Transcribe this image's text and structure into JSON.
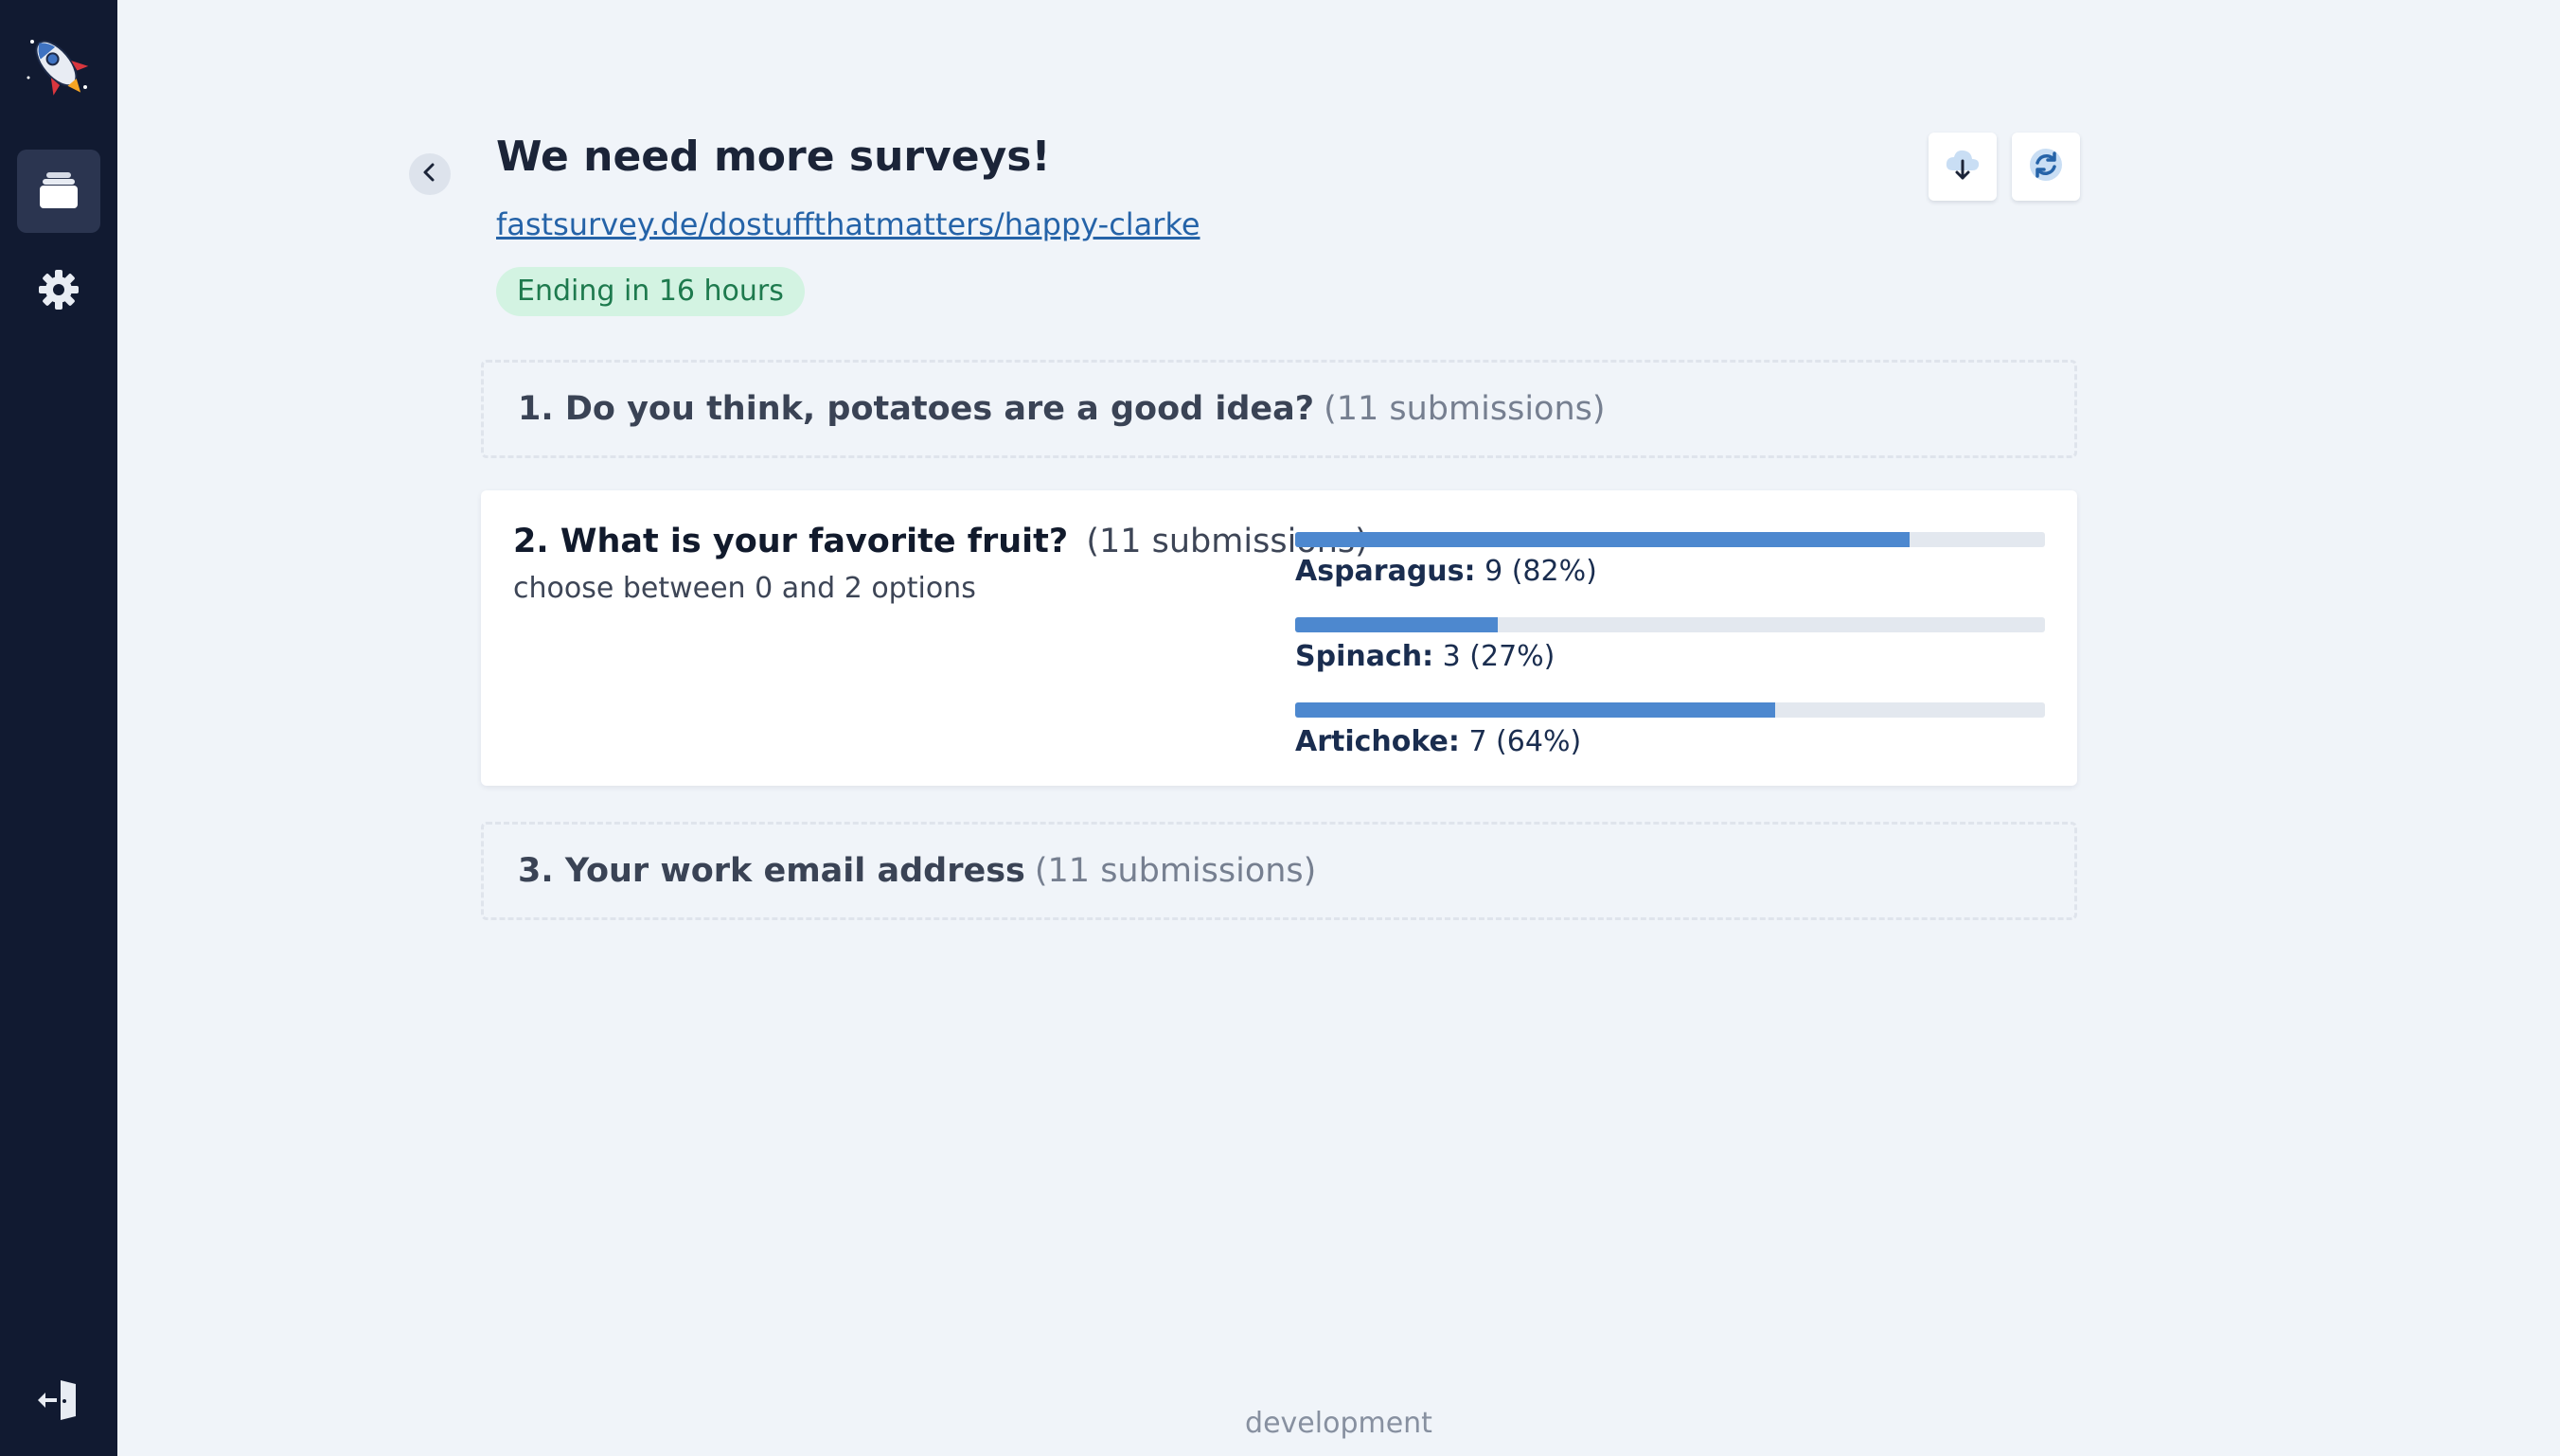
{
  "app": {
    "nav": [
      {
        "id": "surveys",
        "icon": "surveys-stack-icon",
        "active": true
      },
      {
        "id": "settings",
        "icon": "gear-icon",
        "active": false
      }
    ],
    "logout_icon": "logout-icon",
    "logo_icon": "rocket-logo-icon"
  },
  "header": {
    "title": "We need more surveys!",
    "link": "fastsurvey.de/dostuffthatmatters/happy-clarke",
    "status_badge": "Ending in 16 hours",
    "actions": [
      {
        "id": "download",
        "icon": "cloud-download-icon"
      },
      {
        "id": "refresh",
        "icon": "refresh-icon"
      }
    ]
  },
  "questions": [
    {
      "title": "1. Do you think, potatoes are a good idea?",
      "submissions": "(11 submissions)",
      "expanded": false
    },
    {
      "title": "2. What is your favorite fruit?",
      "submissions": "(11 submissions)",
      "hint": "choose between 0 and 2 options",
      "expanded": true,
      "results": [
        {
          "name": "Asparagus:",
          "count": 9,
          "stat": "9 (82%)",
          "fraction": 0.82
        },
        {
          "name": "Spinach:",
          "count": 3,
          "stat": "3 (27%)",
          "fraction": 0.27
        },
        {
          "name": "Artichoke:",
          "count": 7,
          "stat": "7 (64%)",
          "fraction": 0.64
        }
      ]
    },
    {
      "title": "3. Your work email address",
      "submissions": "(11 submissions)",
      "expanded": false
    }
  ],
  "footer": {
    "env": "development"
  },
  "colors": {
    "sidebar": "#111a31",
    "bar": "#4d88cf",
    "badge_bg": "#d3f3e2",
    "badge_text": "#1e7a4e",
    "link": "#2563a8"
  }
}
